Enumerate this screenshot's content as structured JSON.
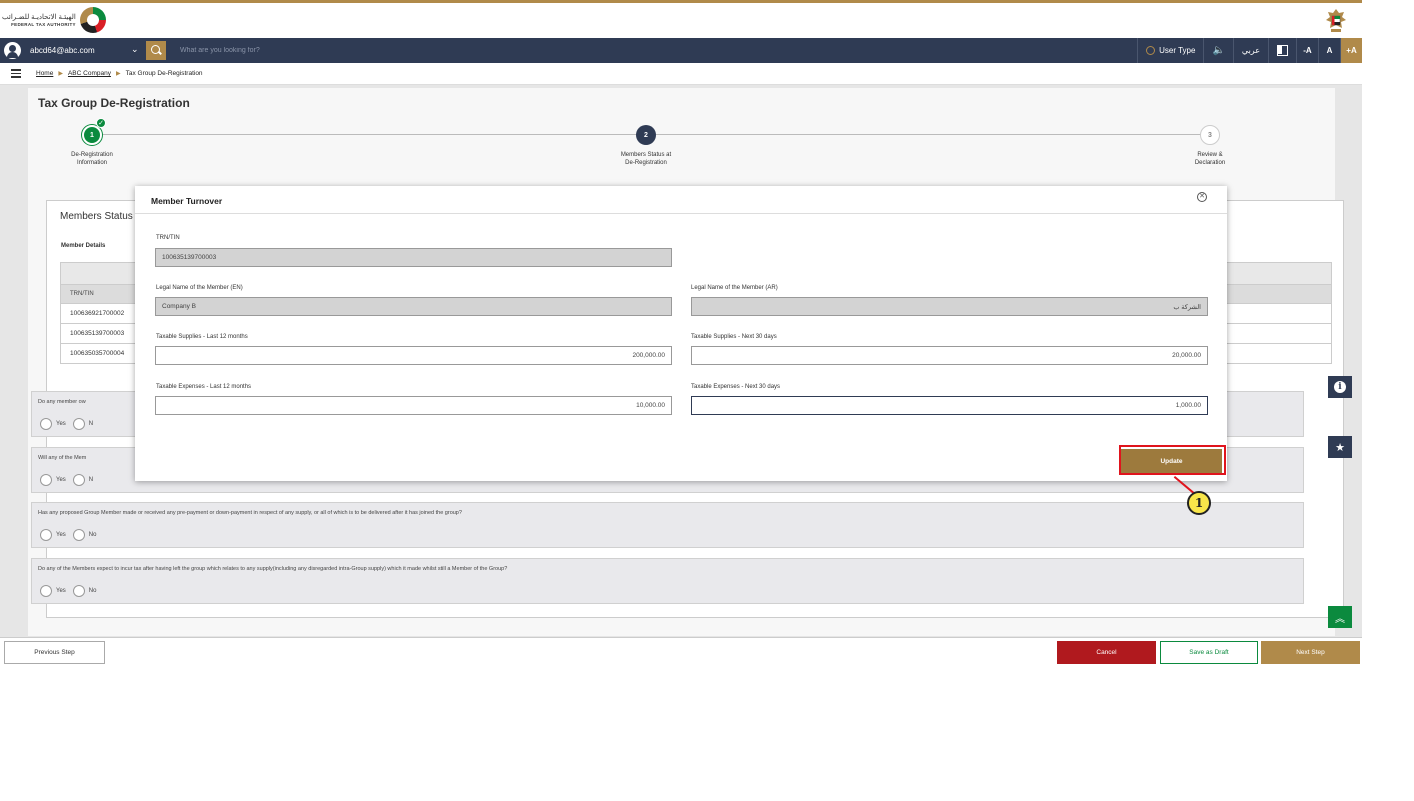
{
  "header": {
    "logo_ar": "الهيئـة الاتحاديـة للضـرائب",
    "logo_en": "FEDERAL TAX AUTHORITY"
  },
  "navbar": {
    "email": "abcd64@abc.com",
    "search_placeholder": "What are you looking for?",
    "user_type": "User Type",
    "speaker": "🔈",
    "arabic": "عربي",
    "font_decrease": "-A",
    "font_normal": "A",
    "font_increase": "+A"
  },
  "breadcrumb": {
    "home": "Home",
    "company": "ABC Company",
    "current": "Tax Group De-Registration"
  },
  "page": {
    "title": "Tax Group De-Registration"
  },
  "stepper": {
    "steps": [
      {
        "num": "1",
        "line1": "De-Registration",
        "line2": "Information",
        "state": "done"
      },
      {
        "num": "2",
        "line1": "Members Status at",
        "line2": "De-Registration",
        "state": "current"
      },
      {
        "num": "3",
        "line1": "Review &",
        "line2": "Declaration",
        "state": "todo"
      }
    ],
    "check": "✓"
  },
  "members": {
    "title": "Members Status",
    "details_label": "Member Details",
    "column_trn": "TRN/TIN",
    "rows": [
      "100636921700002",
      "100635139700003",
      "100635035700004"
    ]
  },
  "questions": [
    {
      "text": "Do any member ow",
      "yes": "Yes",
      "no": "N"
    },
    {
      "text": "Will any of the Mem",
      "yes": "Yes",
      "no": "N"
    },
    {
      "text": "Has any proposed Group Member made or received any pre-payment or down-payment in respect of any supply, or all of which is to be delivered after it has joined the group?",
      "yes": "Yes",
      "no": "No"
    },
    {
      "text": "Do any of the Members expect to incur tax after having left the group which relates to any supply(including any disregarded intra-Group supply) which it made whilst still a Member of the Group?",
      "yes": "Yes",
      "no": "No"
    }
  ],
  "footer": {
    "previous": "Previous Step",
    "cancel": "Cancel",
    "save_draft": "Save as Draft",
    "next": "Next Step"
  },
  "side": {
    "info": "i",
    "star": "★",
    "top": "︽"
  },
  "modal": {
    "title": "Member Turnover",
    "close": "✕",
    "trn_label": "TRN/TIN",
    "trn_value": "100635139700003",
    "name_en_label": "Legal Name of the Member (EN)",
    "name_en_value": "Company B",
    "name_ar_label": "Legal Name of the Member (AR)",
    "name_ar_value": "الشركة ب",
    "supplies_last_label": "Taxable Supplies - Last 12 months",
    "supplies_last_value": "200,000.00",
    "supplies_next_label": "Taxable Supplies - Next 30 days",
    "supplies_next_value": "20,000.00",
    "expenses_last_label": "Taxable Expenses - Last 12 months",
    "expenses_last_value": "10,000.00",
    "expenses_next_label": "Taxable Expenses - Next 30 days",
    "expenses_next_value": "1,000.00",
    "update": "Update"
  },
  "annotation": {
    "badge": "1"
  }
}
